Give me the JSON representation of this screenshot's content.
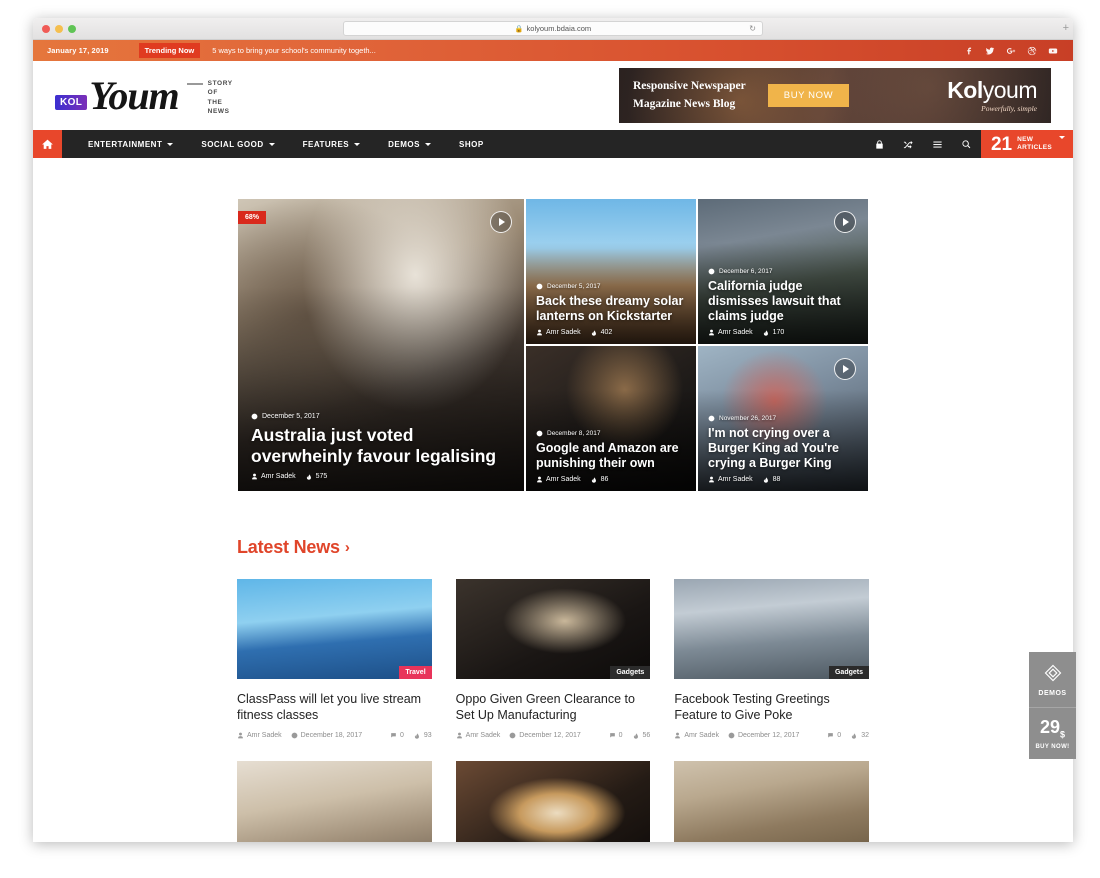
{
  "browser": {
    "url": "kolyoum.bdaia.com",
    "lock_icon": "lock-icon",
    "reload_icon": "reload-icon",
    "new_tab_label": "+"
  },
  "ticker": {
    "date": "January 17, 2019",
    "label": "Trending Now",
    "headline": "5 ways to bring your school's community togeth...",
    "social": [
      {
        "name": "facebook-icon",
        "glyph": "f"
      },
      {
        "name": "twitter-icon",
        "glyph": "t"
      },
      {
        "name": "google-plus-icon",
        "glyph": "G+"
      },
      {
        "name": "dribbble-icon",
        "glyph": "d"
      },
      {
        "name": "youtube-icon",
        "glyph": "y"
      }
    ]
  },
  "header": {
    "logo": {
      "badge": "KOL",
      "word": "Youm",
      "tagline_lines": [
        "STORY",
        "OF",
        "THE",
        "NEWS"
      ]
    },
    "ad": {
      "line1": "Responsive Newspaper",
      "line2": "Magazine News Blog",
      "button": "BUY NOW",
      "brand_bold": "Kol",
      "brand_light": "youm",
      "brand_sub": "Powerfully, simple"
    }
  },
  "nav": {
    "home_icon": "home-icon",
    "items": [
      {
        "label": "ENTERTAINMENT",
        "has_dropdown": true
      },
      {
        "label": "SOCIAL GOOD",
        "has_dropdown": true
      },
      {
        "label": "FEATURES",
        "has_dropdown": true
      },
      {
        "label": "DEMOS",
        "has_dropdown": true
      },
      {
        "label": "SHOP",
        "has_dropdown": false
      }
    ],
    "icons": [
      "lock-icon",
      "shuffle-icon",
      "menu-icon",
      "search-icon"
    ],
    "badge": {
      "count": "21",
      "line1": "NEW",
      "line2": "ARTICLES"
    }
  },
  "hero": {
    "featured": {
      "percent_badge": "68%",
      "date": "December 5, 2017",
      "title": "Australia just voted overwheinly favour legalising",
      "author": "Amr Sadek",
      "views": "575",
      "has_play": true
    },
    "cards": [
      {
        "date": "December 5, 2017",
        "title": "Back these dreamy solar lanterns on Kickstarter",
        "author": "Amr Sadek",
        "views": "402",
        "has_play": false
      },
      {
        "date": "December 6, 2017",
        "title": "California judge dismisses lawsuit that claims judge",
        "author": "Amr Sadek",
        "views": "170",
        "has_play": true
      },
      {
        "date": "December 8, 2017",
        "title": "Google and Amazon are punishing their own",
        "author": "Amr Sadek",
        "views": "86",
        "has_play": false
      },
      {
        "date": "November 26, 2017",
        "title": "I'm not crying over a Burger King ad You're crying a Burger King",
        "author": "Amr Sadek",
        "views": "88",
        "has_play": true
      }
    ]
  },
  "latest_news": {
    "heading": "Latest News",
    "arrow": "›",
    "accent_color": "#e0452a",
    "articles": [
      {
        "category": "Travel",
        "category_color": "#e8345a",
        "title": "ClassPass will let you live stream fitness classes",
        "author": "Amr Sadek",
        "date": "December 18, 2017",
        "comments": "0",
        "views": "93"
      },
      {
        "category": "Gadgets",
        "category_color": "#2b2b2b",
        "title": "Oppo Given Green Clearance to Set Up Manufacturing",
        "author": "Amr Sadek",
        "date": "December 12, 2017",
        "comments": "0",
        "views": "56"
      },
      {
        "category": "Gadgets",
        "category_color": "#2b2b2b",
        "title": "Facebook Testing Greetings Feature to Give Poke",
        "author": "Amr Sadek",
        "date": "December 12, 2017",
        "comments": "0",
        "views": "32"
      }
    ]
  },
  "float_widget": {
    "demos_icon": "diamond-icon",
    "demos_label": "DEMOS",
    "price": "29",
    "currency": "$",
    "buy_label": "BUY NOW!"
  }
}
